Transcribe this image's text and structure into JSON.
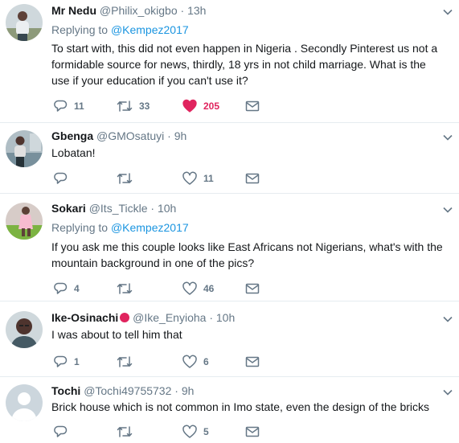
{
  "tweets": [
    {
      "name": "Mr Nedu",
      "handle": "@Philix_okigbo",
      "time": "13h",
      "replying_prefix": "Replying to",
      "replying_to": "@Kempez2017",
      "text": "To start with, this did not even happen in Nigeria . Secondly Pinterest us not a formidable  source for news, thirdly, 18 yrs in not child marriage.  What is the use if your education if you can't use it?",
      "replies": "11",
      "retweets": "33",
      "likes": "205",
      "liked": true
    },
    {
      "name": "Gbenga",
      "handle": "@GMOsatuyi",
      "time": "9h",
      "text": "Lobatan!",
      "replies": "",
      "retweets": "",
      "likes": "11"
    },
    {
      "name": "Sokari",
      "handle": "@Its_Tickle",
      "time": "10h",
      "replying_prefix": "Replying to",
      "replying_to": "@Kempez2017",
      "text": "If you ask me this couple looks like East Africans not Nigerians, what's with the mountain background in one of the pics?",
      "replies": "4",
      "retweets": "",
      "likes": "46"
    },
    {
      "name": "Ike-Osinachi",
      "handle": "@Ike_Enyioha",
      "time": "10h",
      "text": "I was about to tell him that",
      "replies": "1",
      "retweets": "",
      "likes": "6"
    },
    {
      "name": "Tochi",
      "handle": "@Tochi49755732",
      "time": "9h",
      "text": "Brick house which is not common in Imo state, even the design of the bricks",
      "replies": "",
      "retweets": "",
      "likes": "5"
    }
  ],
  "separator": " · ",
  "colors": {
    "accent": "#1b95e0",
    "like": "#e0245e",
    "muted": "#657786",
    "text": "#14171a",
    "border": "#e6ecf0"
  },
  "icons": {
    "reply": "reply-icon",
    "retweet": "retweet-icon",
    "like": "heart-icon",
    "dm": "envelope-icon",
    "menu": "chevron-down-icon"
  }
}
